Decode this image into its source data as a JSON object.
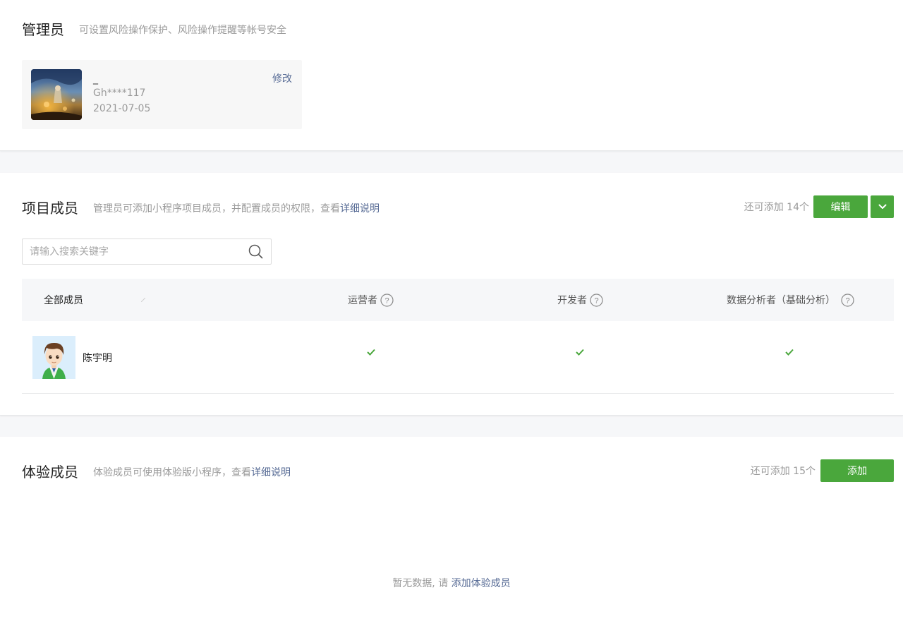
{
  "admin": {
    "title": "管理员",
    "description": "可设置风险操作保护、风险操作提醒等帐号安全",
    "name": "_",
    "masked_id": "Gh****117",
    "date": "2021-07-05",
    "edit_label": "修改"
  },
  "members": {
    "title": "项目成员",
    "description": "管理员可添加小程序项目成员，并配置成员的权限，查看",
    "detail_link": "详细说明",
    "quota": "还可添加 14个",
    "edit_button": "编辑",
    "search_placeholder": "请输入搜索关键字",
    "columns": {
      "all": "全部成员",
      "operator": "运营者",
      "developer": "开发者",
      "analyst": "数据分析者（基础分析）"
    },
    "rows": [
      {
        "name": "陈宇明",
        "operator": true,
        "developer": true,
        "analyst": true
      }
    ]
  },
  "testers": {
    "title": "体验成员",
    "description": "体验成员可使用体验版小程序，查看",
    "detail_link": "详细说明",
    "quota": "还可添加 15个",
    "add_button": "添加",
    "empty_text": "暂无数据, 请 ",
    "empty_link": "添加体验成员"
  },
  "colors": {
    "accent_green": "#4aa73c",
    "link_blue": "#576b95",
    "check_green": "#4aa73c"
  }
}
